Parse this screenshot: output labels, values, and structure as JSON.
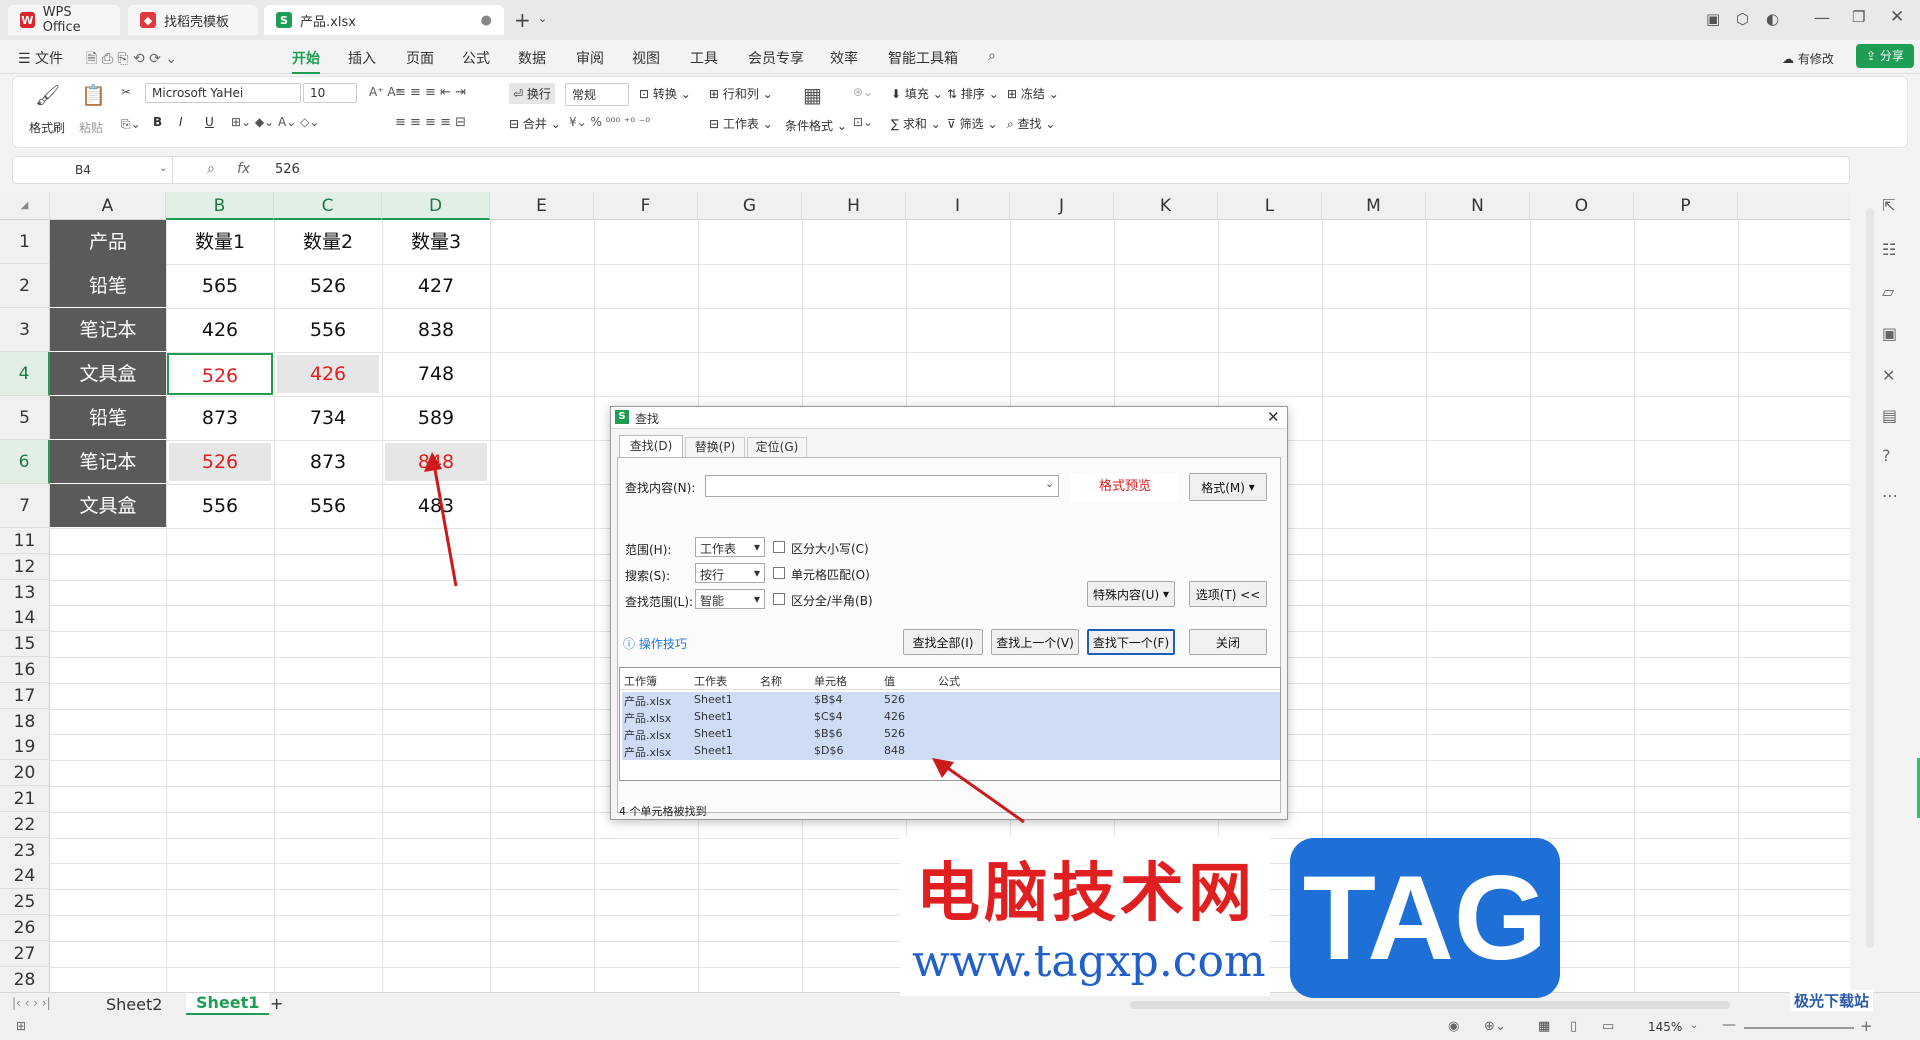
{
  "tabs": [
    {
      "label": "WPS Office"
    },
    {
      "label": "找稻壳模板"
    },
    {
      "label": "产品.xlsx"
    }
  ],
  "menu": {
    "file": "文件",
    "items": [
      "开始",
      "插入",
      "页面",
      "公式",
      "数据",
      "审阅",
      "视图",
      "工具",
      "会员专享",
      "效率",
      "智能工具箱"
    ],
    "active": "开始",
    "modify": "有修改",
    "share": "分享"
  },
  "ribbon": {
    "format_painter": "格式刷",
    "paste": "粘贴",
    "font": "Microsoft YaHei",
    "size": "10",
    "bold": "B",
    "italic": "I",
    "underline": "U",
    "wrap": "换行",
    "merge": "合并",
    "number_format": "常规",
    "convert": "转换",
    "rowcol": "行和列",
    "worksheet": "工作表",
    "cond_format": "条件格式",
    "fill": "填充",
    "sort": "排序",
    "freeze": "冻结",
    "sum": "求和",
    "filter": "筛选",
    "find": "查找"
  },
  "formula": {
    "namebox": "B4",
    "fx": "fx",
    "value": "526"
  },
  "columns": [
    "A",
    "B",
    "C",
    "D",
    "E",
    "F",
    "G",
    "H",
    "I",
    "J",
    "K",
    "L",
    "M",
    "N",
    "O",
    "P"
  ],
  "sheet": {
    "header": [
      "产品",
      "数量1",
      "数量2",
      "数量3"
    ],
    "rows": [
      [
        "铅笔",
        "565",
        "526",
        "427"
      ],
      [
        "笔记本",
        "426",
        "556",
        "838"
      ],
      [
        "文具盒",
        "526",
        "426",
        "748"
      ],
      [
        "铅笔",
        "873",
        "734",
        "589"
      ],
      [
        "笔记本",
        "526",
        "873",
        "848"
      ],
      [
        "文具盒",
        "556",
        "556",
        "483"
      ]
    ],
    "row_numbers": [
      "1",
      "2",
      "3",
      "4",
      "5",
      "6",
      "7",
      "11",
      "12",
      "13",
      "14",
      "15",
      "16",
      "17",
      "18",
      "19",
      "20",
      "21",
      "22",
      "23",
      "24",
      "25",
      "26",
      "27",
      "28"
    ]
  },
  "sheet_tabs": [
    "Sheet2",
    "Sheet1"
  ],
  "zoom": "145%",
  "dialog": {
    "title": "查找",
    "tabs": [
      "查找(D)",
      "替换(P)",
      "定位(G)"
    ],
    "find_label": "查找内容(N):",
    "preview": "格式预览",
    "format_btn": "格式(M)",
    "range_label": "范围(H):",
    "range_val": "工作表",
    "search_label": "搜索(S):",
    "search_val": "按行",
    "scope_label": "查找范围(L):",
    "scope_val": "智能",
    "cb1": "区分大小写(C)",
    "cb2": "单元格匹配(O)",
    "cb3": "区分全/半角(B)",
    "special_btn": "特殊内容(U)",
    "options_btn": "选项(T) <<",
    "tips": "操作技巧",
    "find_all": "查找全部(I)",
    "find_prev": "查找上一个(V)",
    "find_next": "查找下一个(F)",
    "close": "关闭",
    "result_headers": [
      "工作簿",
      "工作表",
      "名称",
      "单元格",
      "值",
      "公式"
    ],
    "results": [
      [
        "产品.xlsx",
        "Sheet1",
        "",
        "$B$4",
        "526"
      ],
      [
        "产品.xlsx",
        "Sheet1",
        "",
        "$C$4",
        "426"
      ],
      [
        "产品.xlsx",
        "Sheet1",
        "",
        "$B$6",
        "526"
      ],
      [
        "产品.xlsx",
        "Sheet1",
        "",
        "$D$6",
        "848"
      ]
    ],
    "status": "4 个单元格被找到"
  },
  "watermark": {
    "cn": "电脑技术网",
    "url": "www.tagxp.com",
    "tag": "TAG",
    "brand": "极光下载站"
  }
}
